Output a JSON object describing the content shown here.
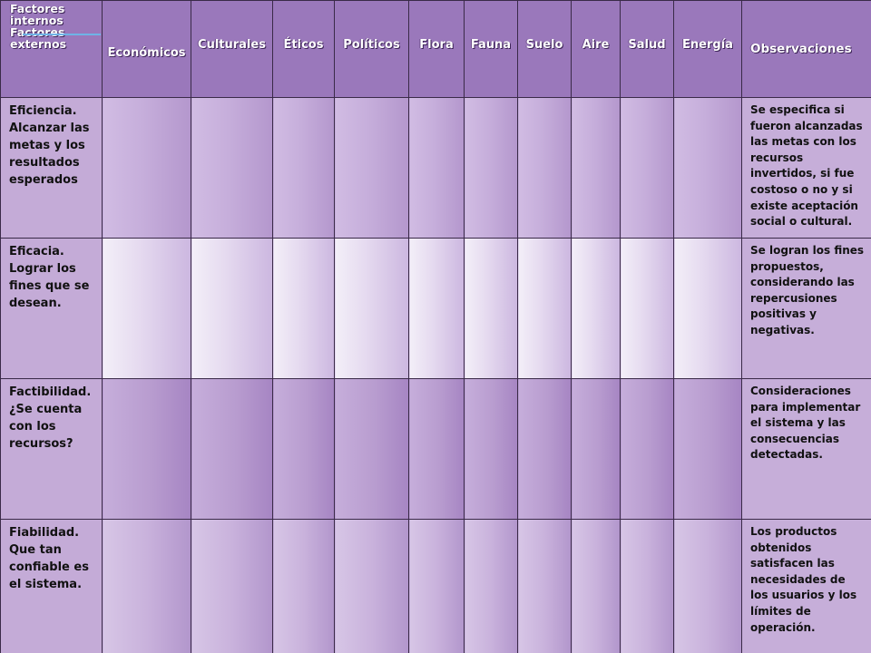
{
  "table": {
    "corner": {
      "line1": "Factores internos",
      "line2": "Factores externos"
    },
    "columns": [
      "Económicos",
      "Culturales",
      "Éticos",
      "Políticos",
      "Flora",
      "Fauna",
      "Suelo",
      "Aire",
      "Salud",
      "Energía"
    ],
    "observations_header": "Observaciones",
    "rows": [
      {
        "label": "Eficiencia. Alcanzar las metas y los resultados esperados",
        "observation": "Se especifica si fueron alcanzadas las metas con los recursos invertidos, si fue costoso o no y si existe aceptación social o cultural."
      },
      {
        "label": "Eficacia. Lograr los fines que se desean.",
        "observation": "Se logran los fines propuestos, considerando las repercusiones positivas y negativas."
      },
      {
        "label": "Factibilidad. ¿Se cuenta con los recursos?",
        "observation": "Consideraciones para implementar el sistema y las consecuencias detectadas."
      },
      {
        "label": "Fiabilidad. Que tan confiable es el sistema.",
        "observation": "Los productos obtenidos satisfacen las necesidades de los usuarios y los límites de operación."
      }
    ]
  }
}
